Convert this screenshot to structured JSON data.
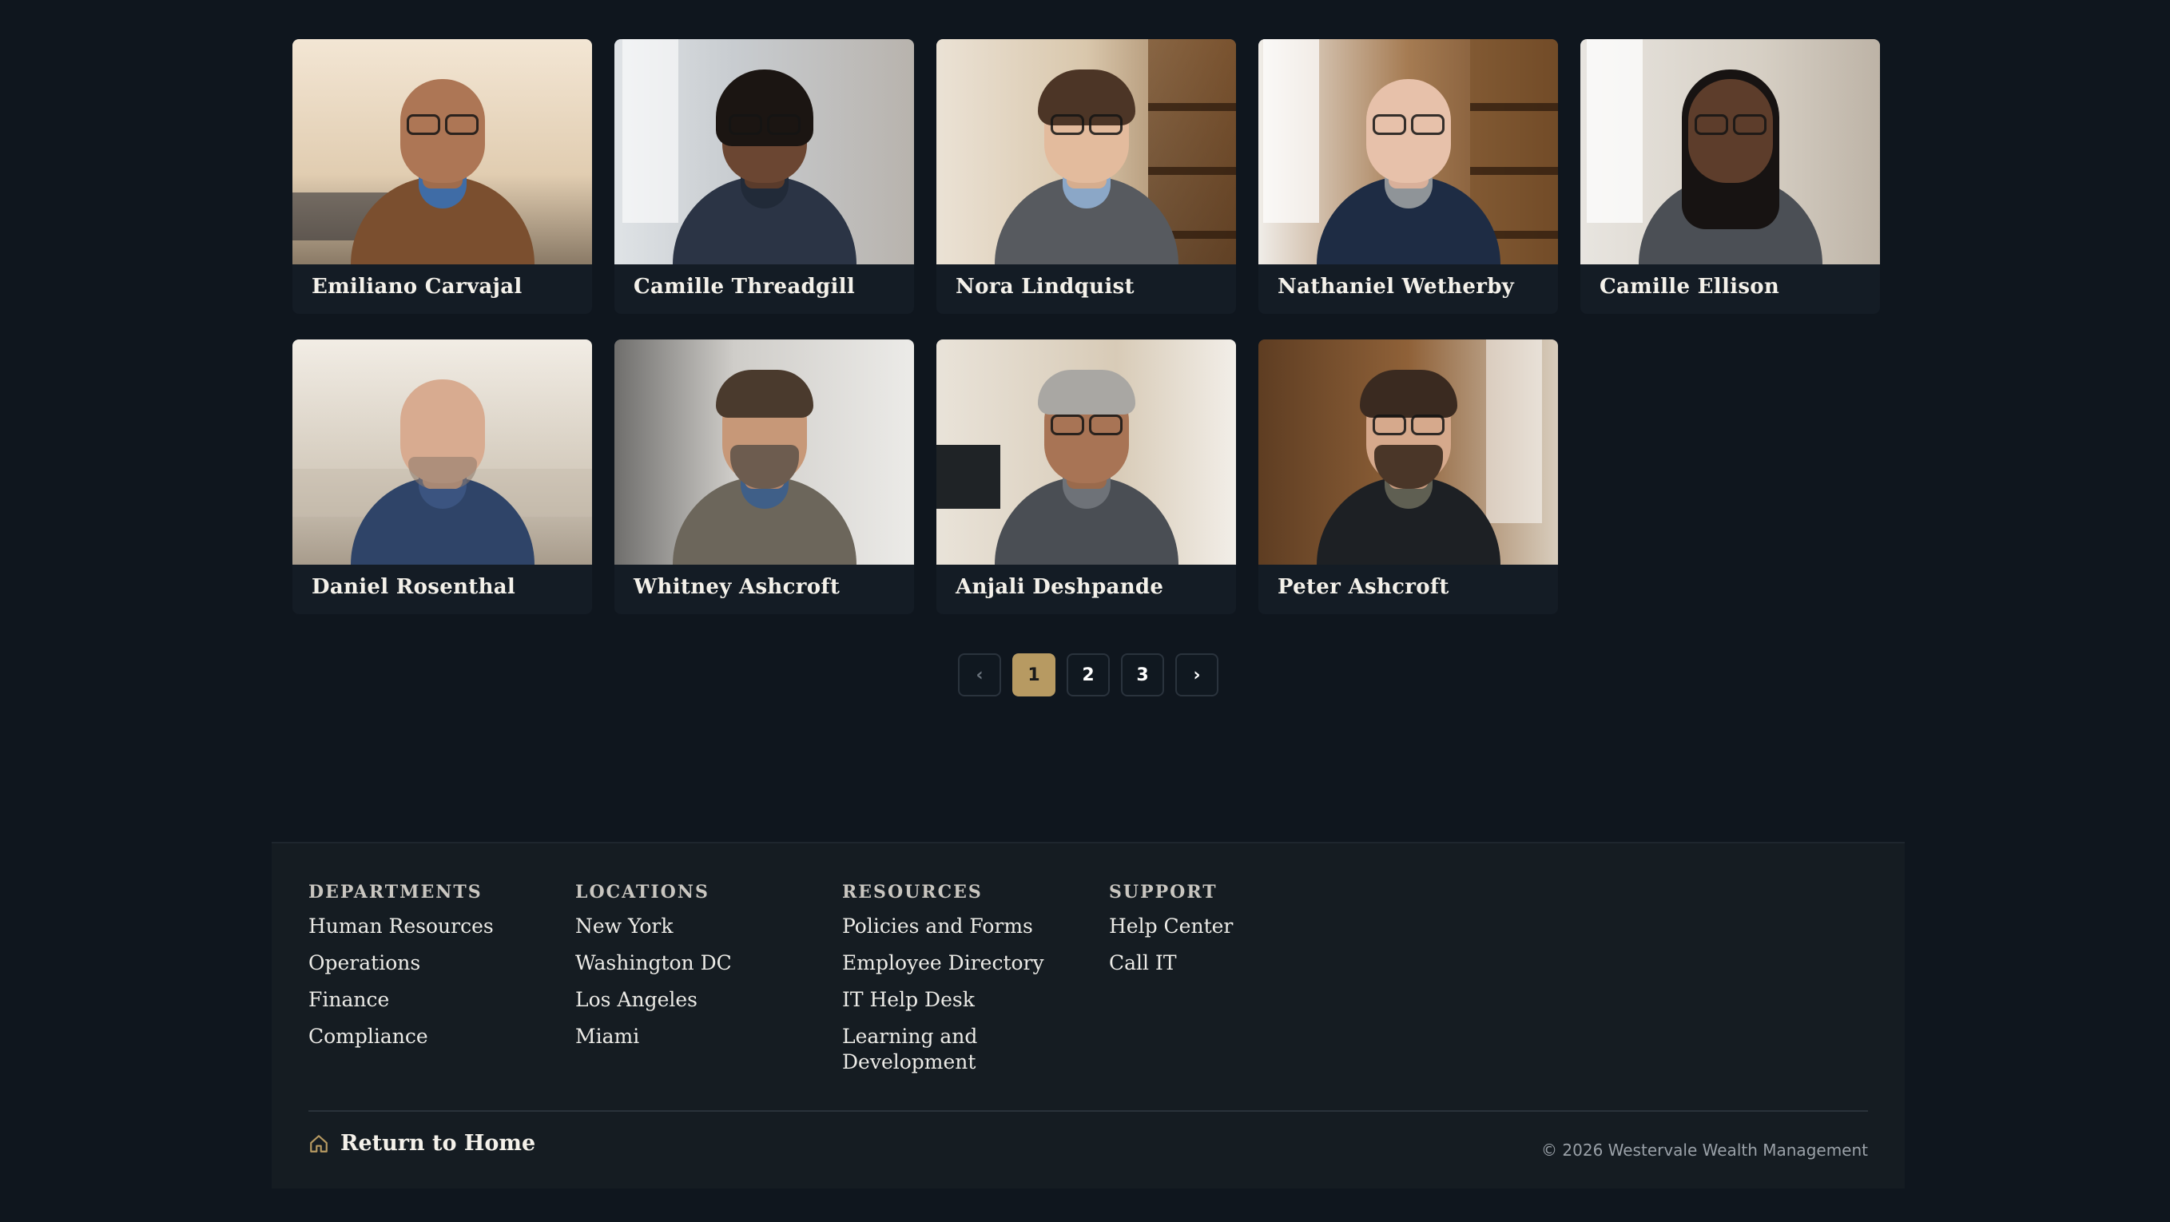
{
  "people": [
    {
      "name": "Emiliano Carvajal"
    },
    {
      "name": "Camille Threadgill"
    },
    {
      "name": "Nora Lindquist"
    },
    {
      "name": "Nathaniel Wetherby"
    },
    {
      "name": "Camille Ellison"
    },
    {
      "name": "Daniel Rosenthal"
    },
    {
      "name": "Whitney Ashcroft"
    },
    {
      "name": "Anjali Deshpande"
    },
    {
      "name": "Peter Ashcroft"
    }
  ],
  "pagination": {
    "prev": "‹",
    "pages": [
      "1",
      "2",
      "3"
    ],
    "current": "1",
    "next": "›"
  },
  "footer": {
    "columns": [
      {
        "heading": "DEPARTMENTS",
        "links": [
          "Human Resources",
          "Operations",
          "Finance",
          "Compliance"
        ]
      },
      {
        "heading": "LOCATIONS",
        "links": [
          "New York",
          "Washington DC",
          "Los Angeles",
          "Miami"
        ]
      },
      {
        "heading": "RESOURCES",
        "links": [
          "Policies and Forms",
          "Employee Directory",
          "IT Help Desk",
          "Learning and Development"
        ]
      },
      {
        "heading": "SUPPORT",
        "links": [
          "Help Center",
          "Call IT"
        ]
      }
    ],
    "return_home": "Return to Home",
    "copyright": "© 2026 Westervale Wealth Management"
  },
  "colors": {
    "background": "#0f161e",
    "card": "#141c25",
    "accent_gold": "#b79a62",
    "footer_bg": "#151c22"
  },
  "icons": {
    "return_home": "home-icon"
  }
}
